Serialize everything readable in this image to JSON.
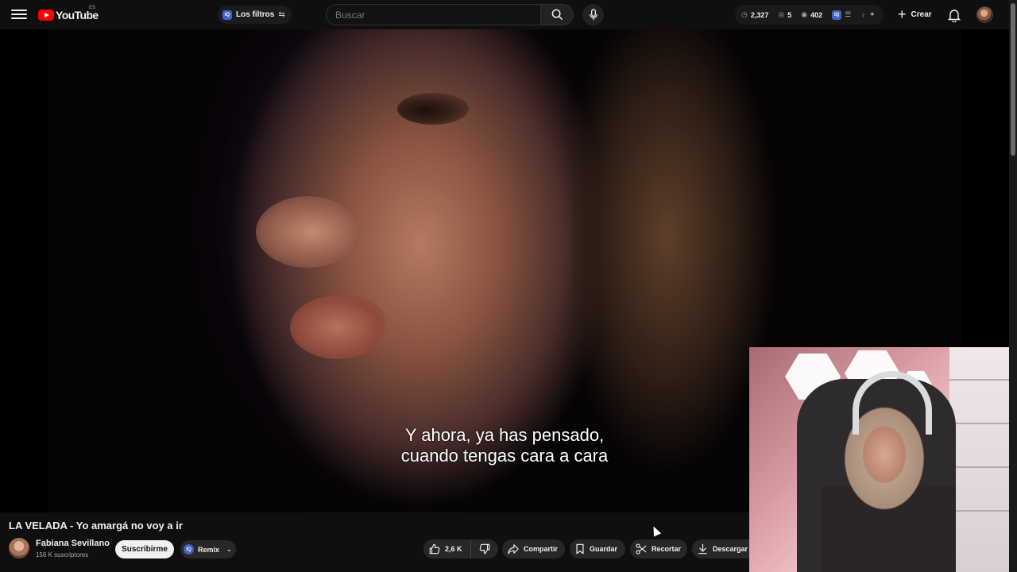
{
  "header": {
    "logo_text": "YouTube",
    "country_code": "ES",
    "filters_badge": "IQ",
    "filters_label": "Los filtros",
    "search_placeholder": "Buscar",
    "stats": {
      "time_value": "2,327",
      "views_value": "5",
      "eye_value": "402"
    },
    "create_label": "Crear"
  },
  "video": {
    "subtitle_line1": "Y ahora, ya has pensado,",
    "subtitle_line2": "cuando tengas cara a cara"
  },
  "info": {
    "title": "LA VELADA - Yo amargá no voy a ir",
    "channel_name": "Fabiana Sevillano",
    "subscribers": "156 K suscriptores",
    "subscribe_label": "Suscribirme",
    "remix_badge": "IQ",
    "remix_label": "Remix"
  },
  "actions": {
    "likes": "2,6 K",
    "share_label": "Compartir",
    "save_label": "Guardar",
    "clip_label": "Recortar",
    "download_label": "Descargar"
  },
  "colors": {
    "brand": "#ff0000",
    "background": "#0f0f0f",
    "button_bg": "#272727",
    "iq_badge": "#3e64c6"
  },
  "icons": [
    "menu-icon",
    "youtube-logo-icon",
    "tune-icon",
    "search-icon",
    "mic-icon",
    "clock-icon",
    "eye-icon",
    "bell-icon",
    "plus-icon",
    "thumb-up-icon",
    "thumb-down-icon",
    "share-icon",
    "bookmark-icon",
    "scissors-icon",
    "download-icon",
    "chevron-down-icon"
  ]
}
